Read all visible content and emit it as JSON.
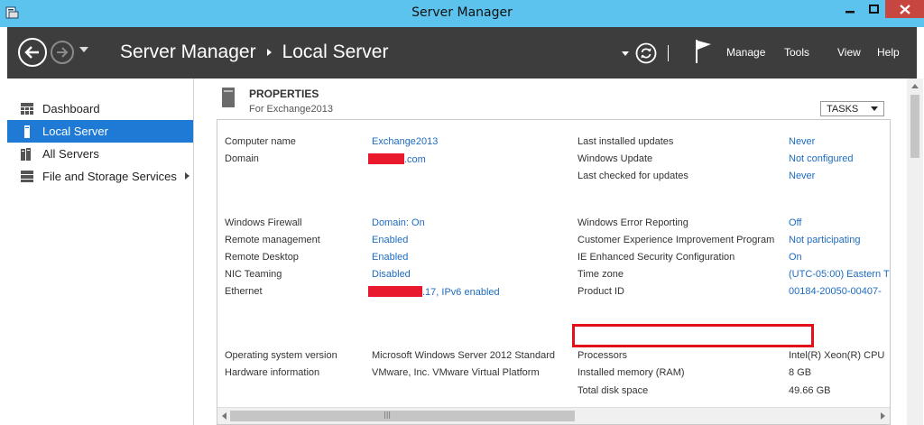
{
  "window": {
    "title": "Server Manager"
  },
  "header": {
    "breadcrumb": [
      "Server Manager",
      "Local Server"
    ],
    "menu": {
      "manage": "Manage",
      "tools": "Tools",
      "view": "View",
      "help": "Help"
    }
  },
  "sidebar": {
    "items": [
      {
        "label": "Dashboard",
        "icon": "dashboard-icon",
        "selected": false
      },
      {
        "label": "Local Server",
        "icon": "server-icon",
        "selected": true
      },
      {
        "label": "All Servers",
        "icon": "servers-icon",
        "selected": false
      },
      {
        "label": "File and Storage Services",
        "icon": "storage-icon",
        "selected": false
      }
    ]
  },
  "properties": {
    "title": "PROPERTIES",
    "subtitle": "For Exchange2013",
    "tasks_label": "TASKS",
    "left": {
      "computer_name": {
        "label": "Computer name",
        "value": "Exchange2013"
      },
      "domain": {
        "label": "Domain",
        "value": ".com"
      },
      "firewall": {
        "label": "Windows Firewall",
        "value": "Domain: On"
      },
      "remote_mgmt": {
        "label": "Remote management",
        "value": "Enabled"
      },
      "remote_desktop": {
        "label": "Remote Desktop",
        "value": "Enabled"
      },
      "nic_teaming": {
        "label": "NIC Teaming",
        "value": "Disabled"
      },
      "ethernet": {
        "label": "Ethernet",
        "value": ".17, IPv6 enabled"
      },
      "os_version": {
        "label": "Operating system version",
        "value": "Microsoft Windows Server 2012 Standard"
      },
      "hardware": {
        "label": "Hardware information",
        "value": "VMware, Inc. VMware Virtual Platform"
      }
    },
    "right": {
      "last_installed": {
        "label": "Last installed updates",
        "value": "Never"
      },
      "windows_update": {
        "label": "Windows Update",
        "value": "Not configured"
      },
      "last_checked": {
        "label": "Last checked for updates",
        "value": "Never"
      },
      "error_reporting": {
        "label": "Windows Error Reporting",
        "value": "Off"
      },
      "ceip": {
        "label": "Customer Experience Improvement Program",
        "value": "Not participating"
      },
      "ie_esc": {
        "label": "IE Enhanced Security Configuration",
        "value": "On"
      },
      "time_zone": {
        "label": "Time zone",
        "value": "(UTC-05:00) Eastern T"
      },
      "product_id": {
        "label": "Product ID",
        "value": "00184-20050-00407-"
      },
      "processors": {
        "label": "Processors",
        "value": "Intel(R) Xeon(R) CPU"
      },
      "memory": {
        "label": "Installed memory (RAM)",
        "value": "8 GB"
      },
      "disk": {
        "label": "Total disk space",
        "value": "49.66 GB"
      }
    }
  },
  "colors": {
    "titlebar": "#5bc3ed",
    "header": "#3d3d3d",
    "selected": "#1e7ad4",
    "link": "#1e6cc0",
    "highlight": "#e3101b",
    "redaction": "#e8192c"
  }
}
